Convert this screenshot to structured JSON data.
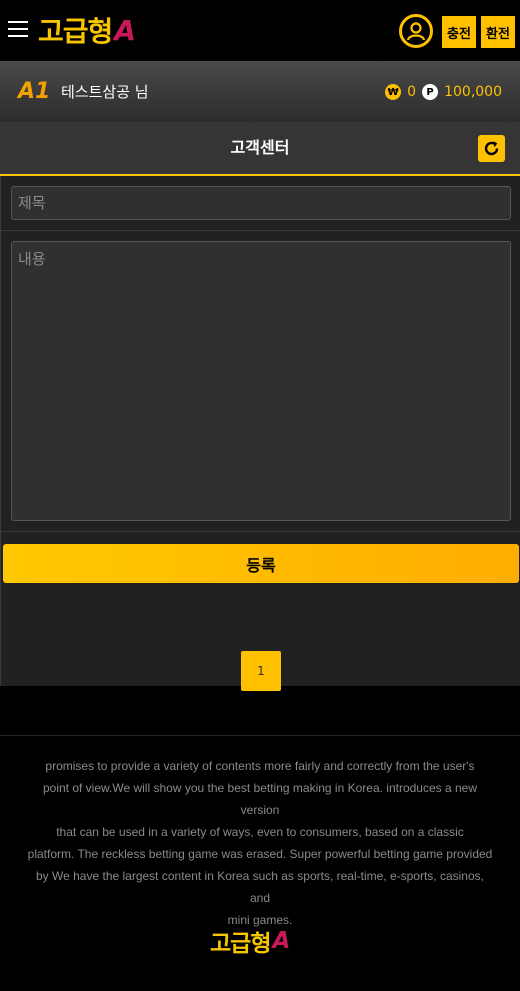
{
  "header": {
    "logo_text": "고급형",
    "logo_accent": "A",
    "charge_label": "충전",
    "exchange_label": "환전"
  },
  "user": {
    "level_badge": "A1",
    "name": "테스트삼공 님",
    "money": "0",
    "point": "100,000",
    "won_symbol": "₩",
    "point_symbol": "P"
  },
  "page": {
    "title": "고객센터"
  },
  "form": {
    "subject_placeholder": "제목",
    "content_placeholder": "내용",
    "submit_label": "등록"
  },
  "pagination": {
    "current": "1"
  },
  "footer": {
    "lines": [
      "promises to provide a variety of contents more fairly and correctly from the user's",
      "point of view.We will show you the best betting making in Korea. introduces a new version",
      "that can be used in a variety  of ways, even to consumers, based on a classic",
      "platform. The reckless betting game was erased. Super powerful betting game provided",
      "by  We have the largest content in Korea such as sports, real-time, e-sports, casinos, and",
      "mini games."
    ],
    "logo_text": "고급형",
    "logo_accent": "A"
  },
  "colors": {
    "accent": "#ffc000",
    "background": "#000000",
    "panel": "#212121"
  }
}
